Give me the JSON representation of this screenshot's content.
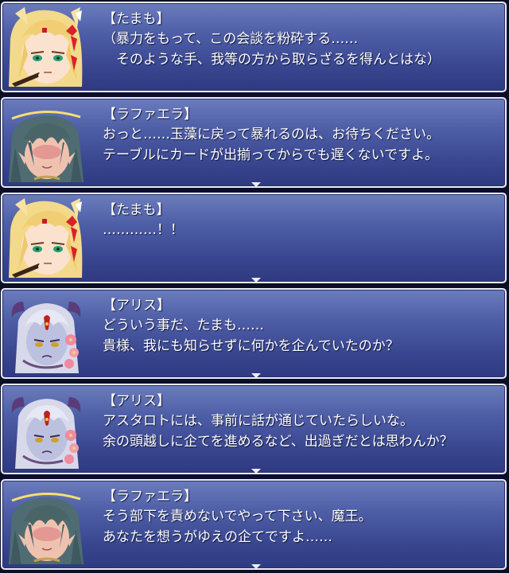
{
  "dialogues": [
    {
      "character": "tamamo",
      "speaker": "【たまも】",
      "lines": [
        "（暴力をもって、この会談を粉砕する……",
        "　そのような手、我等の方から取らざるを得んとはな）"
      ],
      "show_arrow": false
    },
    {
      "character": "raphaela",
      "speaker": "【ラファエラ】",
      "lines": [
        "おっと……玉藻に戻って暴れるのは、お待ちください。",
        "テーブルにカードが出揃ってからでも遅くないですよ。"
      ],
      "show_arrow": true
    },
    {
      "character": "tamamo",
      "speaker": "【たまも】",
      "lines": [
        "…………！！",
        ""
      ],
      "show_arrow": true
    },
    {
      "character": "alice",
      "speaker": "【アリス】",
      "lines": [
        "どういう事だ、たまも……",
        "貴様、我にも知らせずに何かを企んでいたのか？"
      ],
      "show_arrow": true
    },
    {
      "character": "alice",
      "speaker": "【アリス】",
      "lines": [
        "アスタロトには、事前に話が通じていたらしいな。",
        "余の頭越しに企てを進めるなど、出過ぎだとは思わんか？"
      ],
      "show_arrow": true
    },
    {
      "character": "raphaela",
      "speaker": "【ラファエラ】",
      "lines": [
        "そう部下を責めないでやって下さい、魔王。",
        "あなたを想うがゆえの企てですよ……"
      ],
      "show_arrow": true
    }
  ],
  "colors": {
    "window_top": "#6b7cbd",
    "window_bottom": "#2e3a80",
    "border": "#e8ecf4",
    "text": "#ffffff"
  }
}
